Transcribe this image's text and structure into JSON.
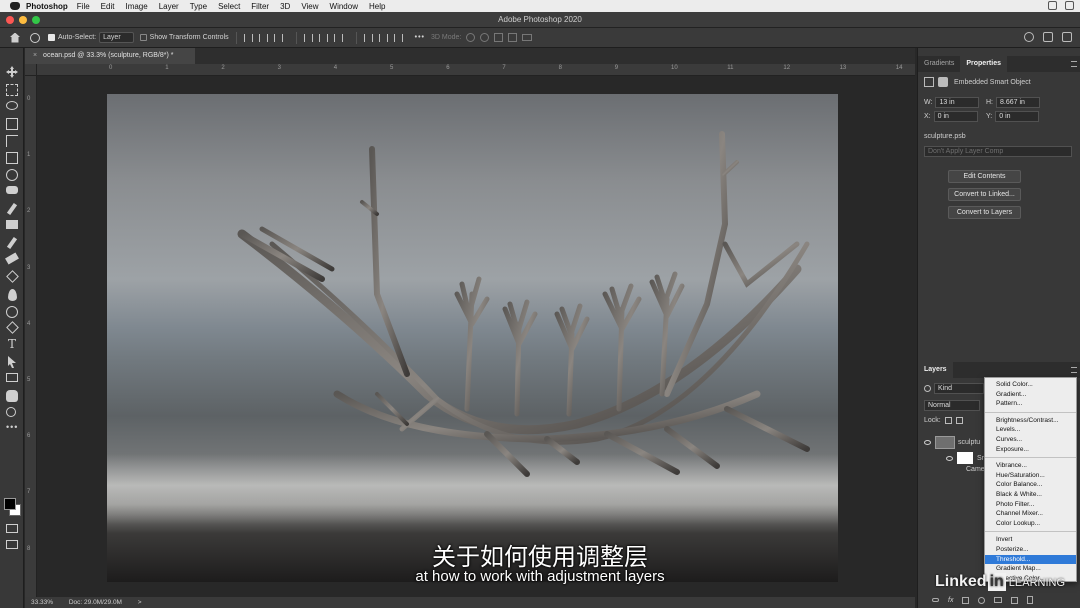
{
  "menubar": {
    "app_name": "Photoshop",
    "items": [
      "File",
      "Edit",
      "Image",
      "Layer",
      "Type",
      "Select",
      "Filter",
      "3D",
      "View",
      "Window",
      "Help"
    ]
  },
  "window": {
    "title": "Adobe Photoshop 2020"
  },
  "options_bar": {
    "auto_select_label": "Auto-Select:",
    "auto_select_target": "Layer",
    "show_transform_label": "Show Transform Controls",
    "mode_3d_label": "3D Mode:"
  },
  "document": {
    "tab_title": "ocean.psd @ 33.3% (sculpture, RGB/8*) *",
    "close_symbol": "×",
    "ruler_h_ticks": [
      "0",
      "1",
      "2",
      "3",
      "4",
      "5",
      "6",
      "7",
      "8",
      "9",
      "10",
      "11",
      "12",
      "13",
      "14"
    ],
    "ruler_v_ticks": [
      "0",
      "1",
      "2",
      "3",
      "4",
      "5",
      "6",
      "7",
      "8"
    ]
  },
  "status_bar": {
    "zoom": "33.33%",
    "doc_size": "Doc: 29.0M/29.0M",
    "arrow": ">"
  },
  "panels": {
    "top_tabs": [
      "Gradients",
      "Properties"
    ],
    "properties": {
      "object_type": "Embedded Smart Object",
      "w_label": "W:",
      "w_value": "13 in",
      "h_label": "H:",
      "h_value": "8.667 in",
      "x_label": "X:",
      "x_value": "0 in",
      "y_label": "Y:",
      "y_value": "0 in",
      "linked_file": "sculpture.psb",
      "layer_comp": "Don't Apply Layer Comp",
      "buttons": [
        "Edit Contents",
        "Convert to Linked...",
        "Convert to Layers"
      ]
    },
    "layers": {
      "tab": "Layers",
      "filter": "Kind",
      "blend_mode": "Normal",
      "lock_label": "Lock:",
      "layer_name": "sculptu",
      "sub_layer_prefix": "Sr",
      "sub_layer_caption": "Came"
    }
  },
  "adjustment_menu": {
    "groups": [
      [
        "Solid Color...",
        "Gradient...",
        "Pattern..."
      ],
      [
        "Brightness/Contrast...",
        "Levels...",
        "Curves...",
        "Exposure..."
      ],
      [
        "Vibrance...",
        "Hue/Saturation...",
        "Color Balance...",
        "Black & White...",
        "Photo Filter...",
        "Channel Mixer...",
        "Color Lookup..."
      ],
      [
        "Invert",
        "Posterize...",
        "Threshold...",
        "Gradient Map...",
        "Selective Color..."
      ]
    ],
    "highlighted": "Threshold..."
  },
  "subtitles": {
    "zh": "关于如何使用调整层",
    "en": "at how to work with adjustment layers"
  },
  "watermark": {
    "brand": "Linked",
    "box": "in",
    "sub": "LEARNING"
  },
  "colors": {
    "highlight": "#2f7ad8",
    "panel_bg": "#383838",
    "traffic_red": "#fc5753",
    "traffic_yellow": "#fdbc40",
    "traffic_green": "#33c748"
  }
}
